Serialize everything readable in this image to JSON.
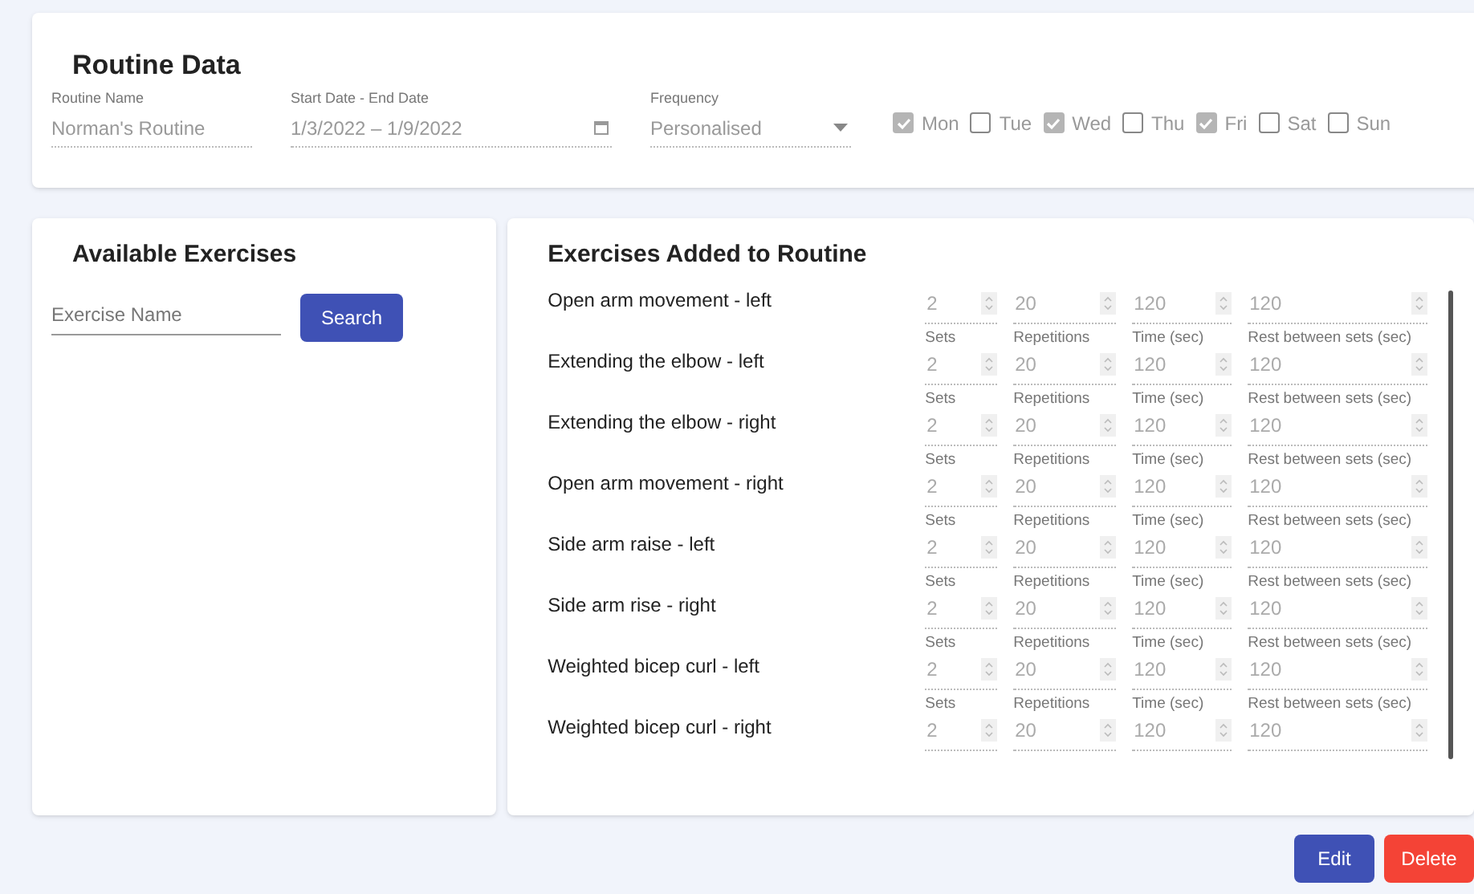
{
  "routine": {
    "title": "Routine Data",
    "name_field": {
      "label": "Routine Name",
      "value": "Norman's Routine"
    },
    "date_field": {
      "label": "Start Date - End Date",
      "value": "1/3/2022 – 1/9/2022"
    },
    "frequency_field": {
      "label": "Frequency",
      "value": "Personalised"
    },
    "days": [
      {
        "label": "Mon",
        "checked": true
      },
      {
        "label": "Tue",
        "checked": false
      },
      {
        "label": "Wed",
        "checked": true
      },
      {
        "label": "Thu",
        "checked": false
      },
      {
        "label": "Fri",
        "checked": true
      },
      {
        "label": "Sat",
        "checked": false
      },
      {
        "label": "Sun",
        "checked": false
      }
    ]
  },
  "available": {
    "title": "Available Exercises",
    "search": {
      "placeholder": "Exercise Name"
    },
    "search_button": "Search"
  },
  "added": {
    "title": "Exercises Added to Routine",
    "rows": [
      {
        "name": "Open arm movement - left",
        "fields": [
          {
            "value": "2"
          },
          {
            "value": "20"
          },
          {
            "value": "120"
          },
          {
            "value": "120"
          }
        ]
      },
      {
        "name": "Extending the elbow - left",
        "fields": [
          {
            "label": "Sets",
            "value": "2"
          },
          {
            "label": "Repetitions",
            "value": "20"
          },
          {
            "label": "Time (sec)",
            "value": "120"
          },
          {
            "label": "Rest between sets (sec)",
            "value": "120"
          }
        ]
      },
      {
        "name": "Extending the elbow - right",
        "fields": [
          {
            "label": "Sets",
            "value": "2"
          },
          {
            "label": "Repetitions",
            "value": "20"
          },
          {
            "label": "Time (sec)",
            "value": "120"
          },
          {
            "label": "Rest between sets (sec)",
            "value": "120"
          }
        ]
      },
      {
        "name": "Open arm movement - right",
        "fields": [
          {
            "label": "Sets",
            "value": "2"
          },
          {
            "label": "Repetitions",
            "value": "20"
          },
          {
            "label": "Time (sec)",
            "value": "120"
          },
          {
            "label": "Rest between sets (sec)",
            "value": "120"
          }
        ]
      },
      {
        "name": "Side arm raise - left",
        "fields": [
          {
            "label": "Sets",
            "value": "2"
          },
          {
            "label": "Repetitions",
            "value": "20"
          },
          {
            "label": "Time (sec)",
            "value": "120"
          },
          {
            "label": "Rest between sets (sec)",
            "value": "120"
          }
        ]
      },
      {
        "name": "Side arm rise - right",
        "fields": [
          {
            "label": "Sets",
            "value": "2"
          },
          {
            "label": "Repetitions",
            "value": "20"
          },
          {
            "label": "Time (sec)",
            "value": "120"
          },
          {
            "label": "Rest between sets (sec)",
            "value": "120"
          }
        ]
      },
      {
        "name": "Weighted bicep curl - left",
        "fields": [
          {
            "label": "Sets",
            "value": "2"
          },
          {
            "label": "Repetitions",
            "value": "20"
          },
          {
            "label": "Time (sec)",
            "value": "120"
          },
          {
            "label": "Rest between sets (sec)",
            "value": "120"
          }
        ]
      },
      {
        "name": "Weighted bicep curl - right",
        "fields": [
          {
            "label": "Sets",
            "value": "2"
          },
          {
            "label": "Repetitions",
            "value": "20"
          },
          {
            "label": "Time (sec)",
            "value": "120"
          },
          {
            "label": "Rest between sets (sec)",
            "value": "120"
          }
        ]
      }
    ]
  },
  "buttons": [
    {
      "label": "Edit",
      "kind": "primary"
    },
    {
      "label": "Delete",
      "kind": "danger"
    }
  ]
}
